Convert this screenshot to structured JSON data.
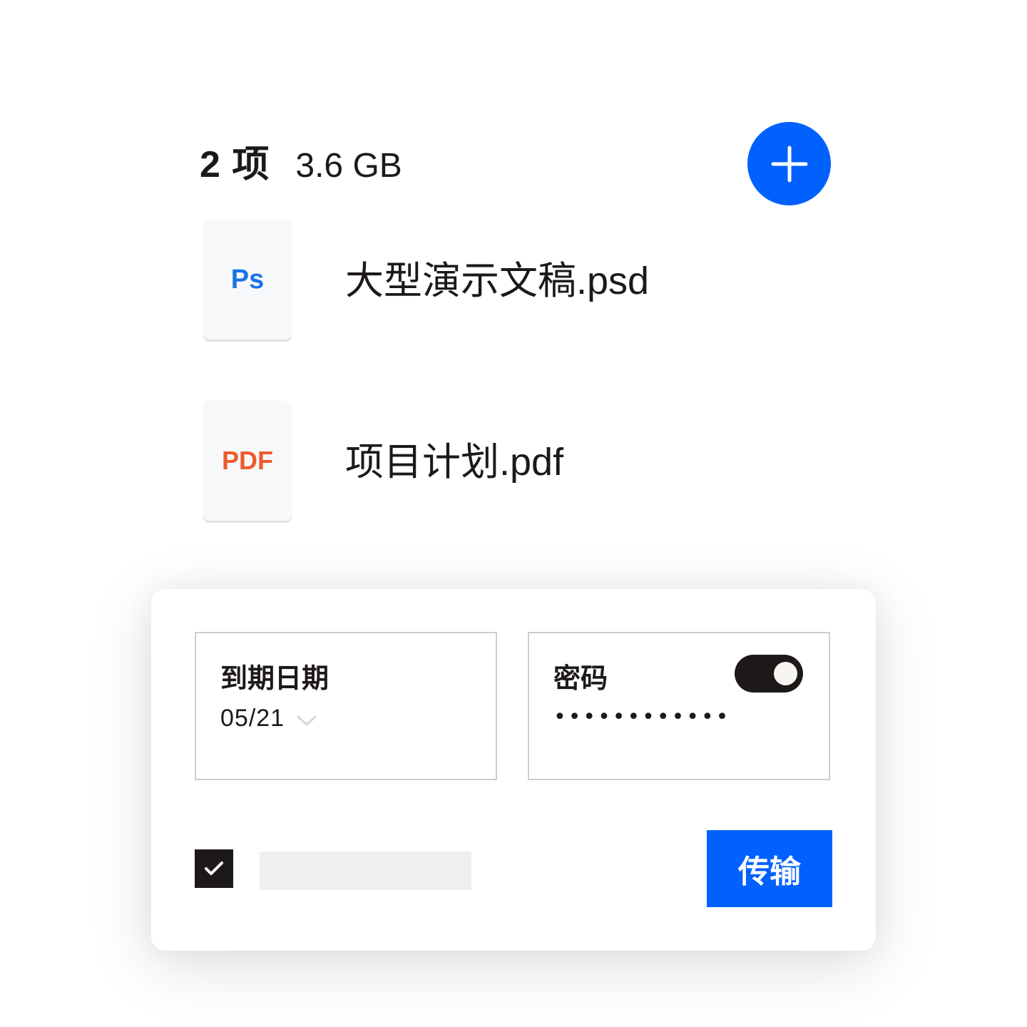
{
  "header": {
    "item_count": "2 项",
    "total_size": "3.6 GB"
  },
  "add_button": {
    "icon": "plus-icon",
    "color": "#0061fe"
  },
  "files": [
    {
      "thumb_label": "Ps",
      "thumb_color": "#1a73e8",
      "name": "大型演示文稿.psd"
    },
    {
      "thumb_label": "PDF",
      "thumb_color": "#ef5a2d",
      "name": "项目计划.pdf"
    }
  ],
  "settings": {
    "expiry": {
      "label": "到期日期",
      "value": "05/21",
      "icon": "chevron-down-icon"
    },
    "password": {
      "label": "密码",
      "enabled": true,
      "value": "••••••••••••"
    },
    "checkbox": {
      "checked": true,
      "icon": "checkmark-icon"
    },
    "transfer_button": {
      "label": "传输",
      "color": "#0061fe"
    }
  }
}
